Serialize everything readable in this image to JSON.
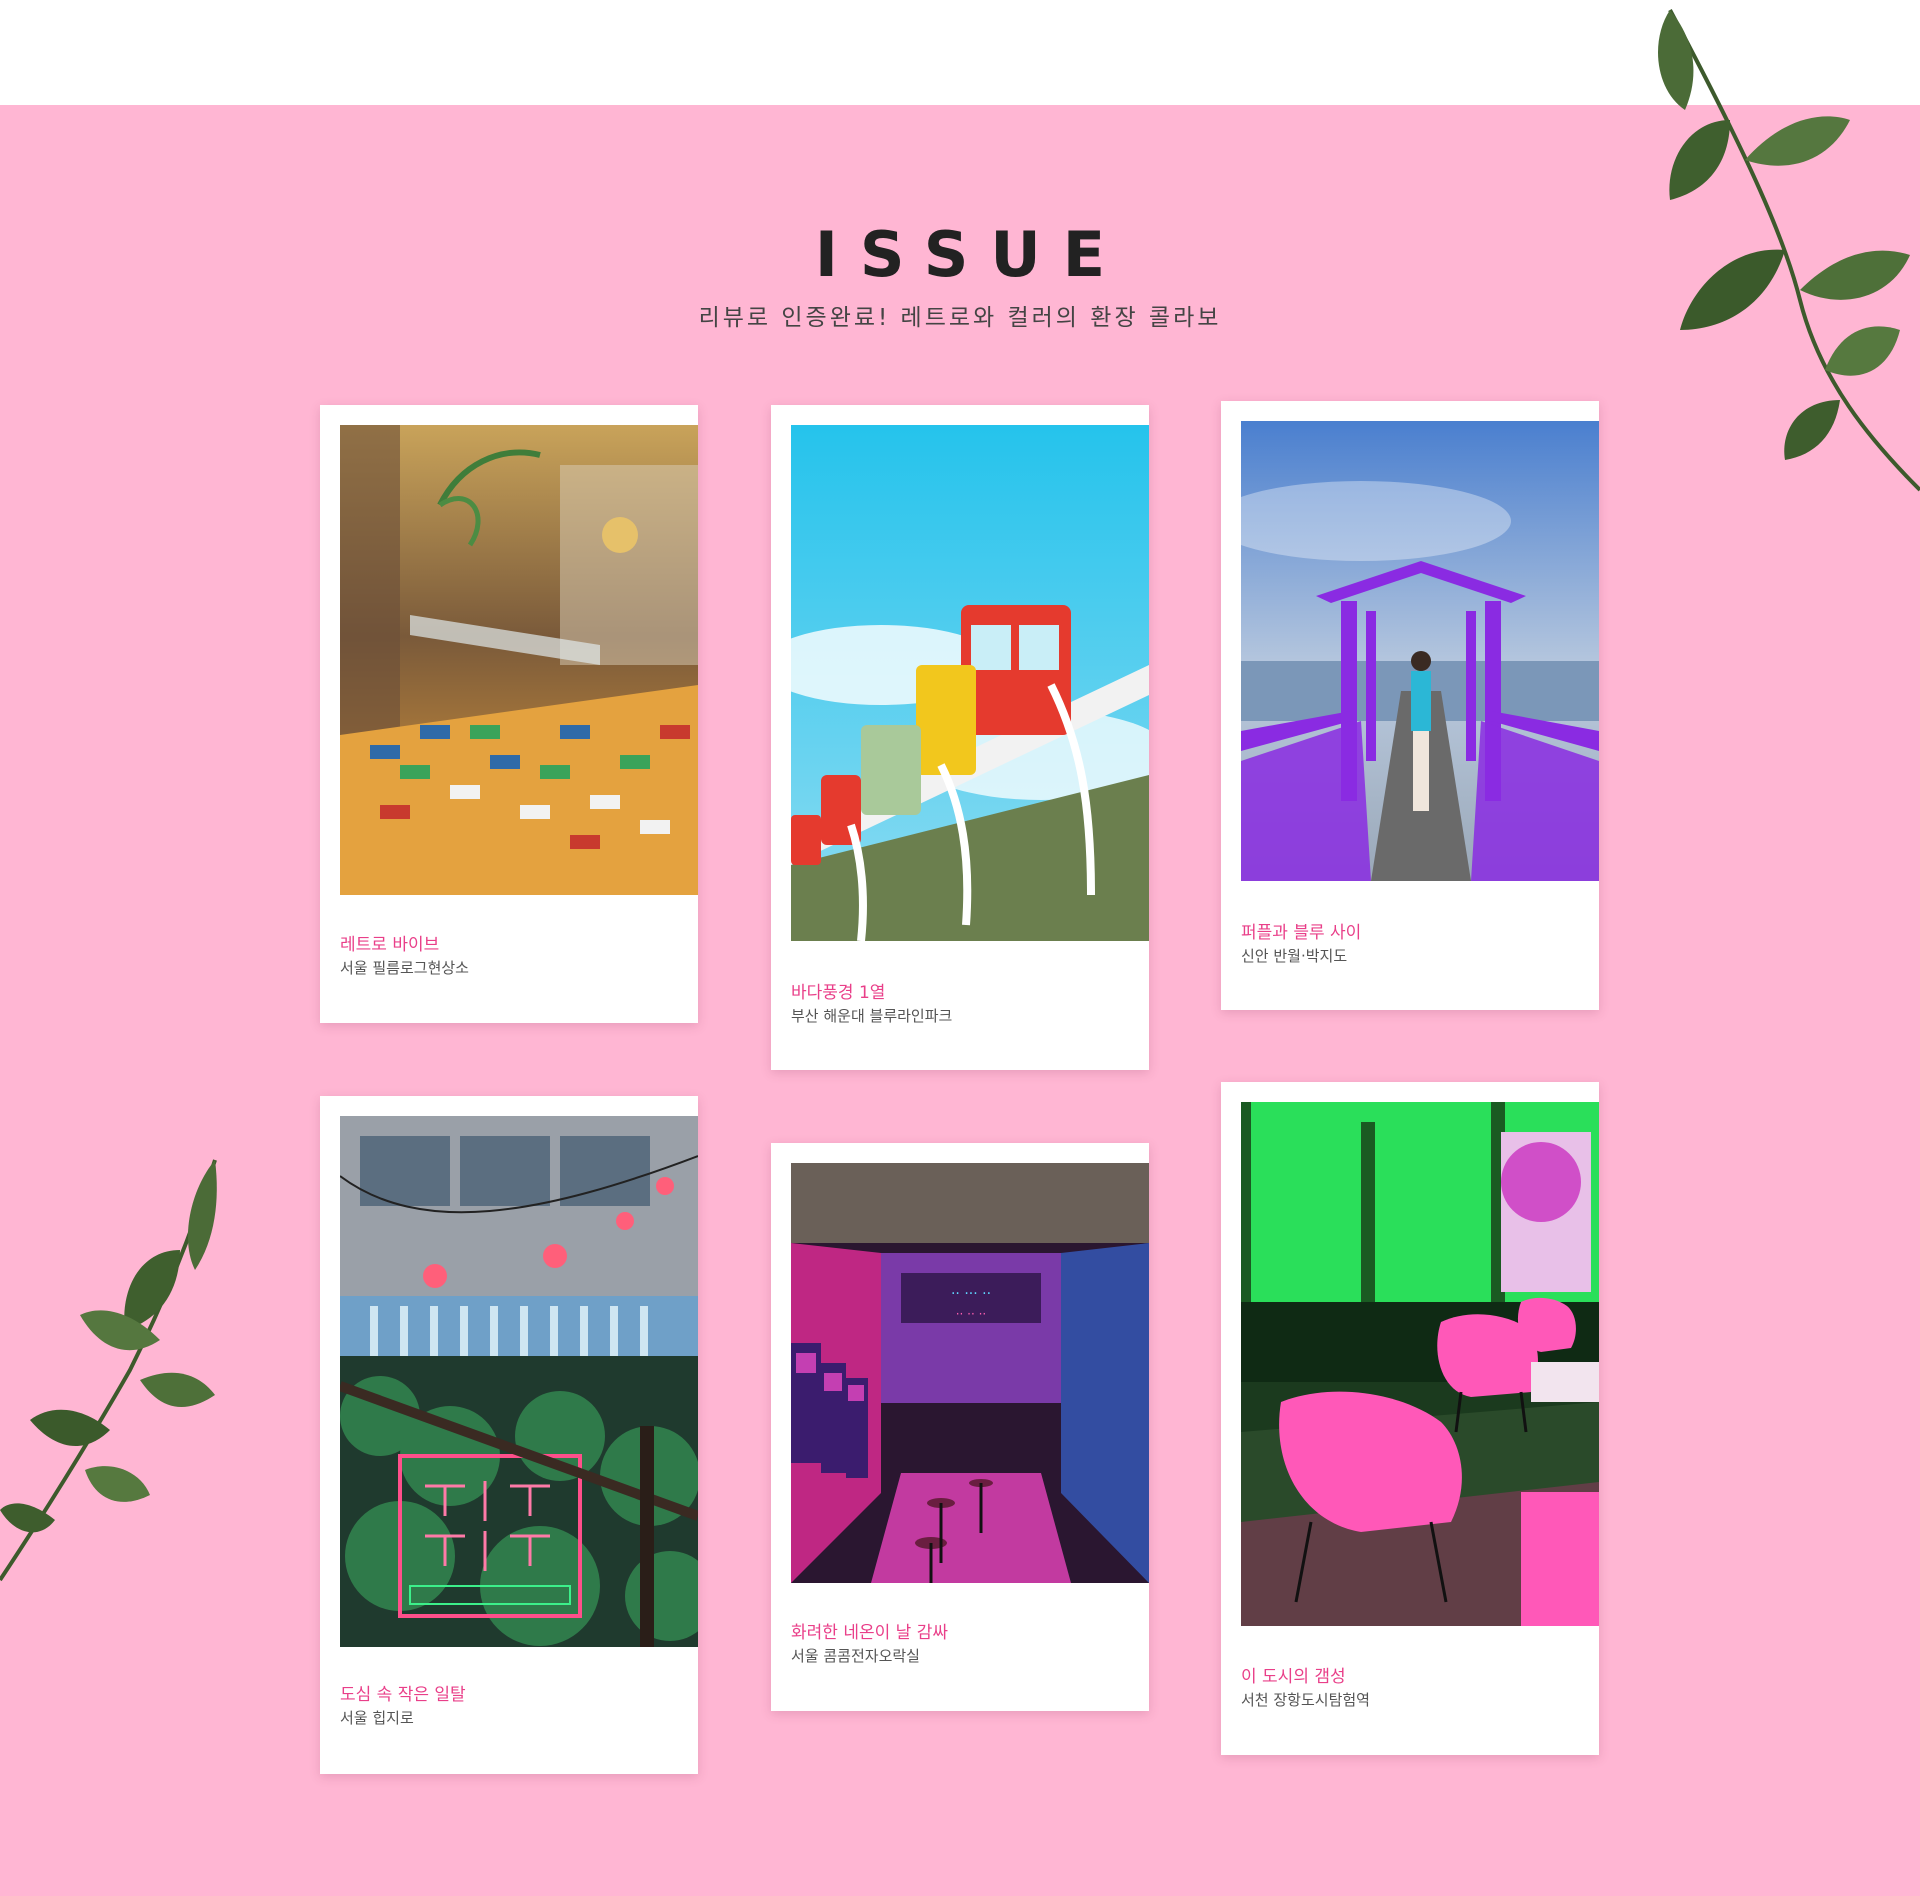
{
  "section": {
    "title": "ISSUE",
    "subtitle": "리뷰로 인증완료! 레트로와 컬러의 환장 콜라보"
  },
  "cards": [
    {
      "title": "레트로 바이브",
      "location": "서울 필름로그현상소",
      "image": "film-shop-photo"
    },
    {
      "title": "바다풍경 1열",
      "location": "부산 해운대 블루라인파크",
      "image": "sky-capsule-train-photo"
    },
    {
      "title": "퍼플과 블루 사이",
      "location": "신안 반월·박지도",
      "image": "purple-bridge-photo"
    },
    {
      "title": "도심 속 작은 일탈",
      "location": "서울 힙지로",
      "image": "neon-sign-garden-photo"
    },
    {
      "title": "화려한 네온이 날 감싸",
      "location": "서울 콤콤전자오락실",
      "image": "neon-arcade-photo"
    },
    {
      "title": "이 도시의 갬성",
      "location": "서천 장항도시탐험역",
      "image": "green-neon-lounge-photo"
    }
  ],
  "colors": {
    "background": "#ffb6d3",
    "caption_title": "#e93f89",
    "heading": "#222222"
  },
  "decor": [
    "leaf-branch-top-right",
    "leaf-branch-left"
  ]
}
